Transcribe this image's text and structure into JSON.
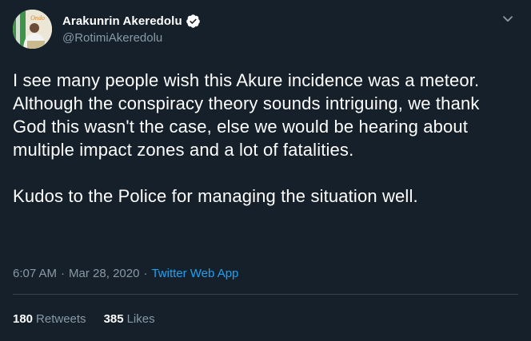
{
  "author": {
    "display_name": "Arakunrin Akeredolu",
    "handle": "@RotimiAkeredolu",
    "verified": true,
    "avatar_logo_text": "Ondo"
  },
  "tweet": {
    "text": "I see many people wish this Akure incidence was a meteor. Although the conspiracy theory sounds intriguing, we thank God this wasn't the case, else we would be hearing about multiple impact zones and a lot of fatalities.\n\nKudos to the Police for managing the situation well.",
    "time": "6:07 AM",
    "separator": "·",
    "date": "Mar 28, 2020",
    "source": "Twitter Web App"
  },
  "stats": {
    "retweets_count": "180",
    "retweets_label": "Retweets",
    "likes_count": "385",
    "likes_label": "Likes"
  },
  "icons": {
    "more": "chevron-down-icon",
    "verified": "verified-badge-icon"
  },
  "colors": {
    "background": "#15202b",
    "text_primary": "#ffffff",
    "text_secondary": "#8899a6",
    "link": "#1da1f2",
    "divider": "#38444d"
  }
}
